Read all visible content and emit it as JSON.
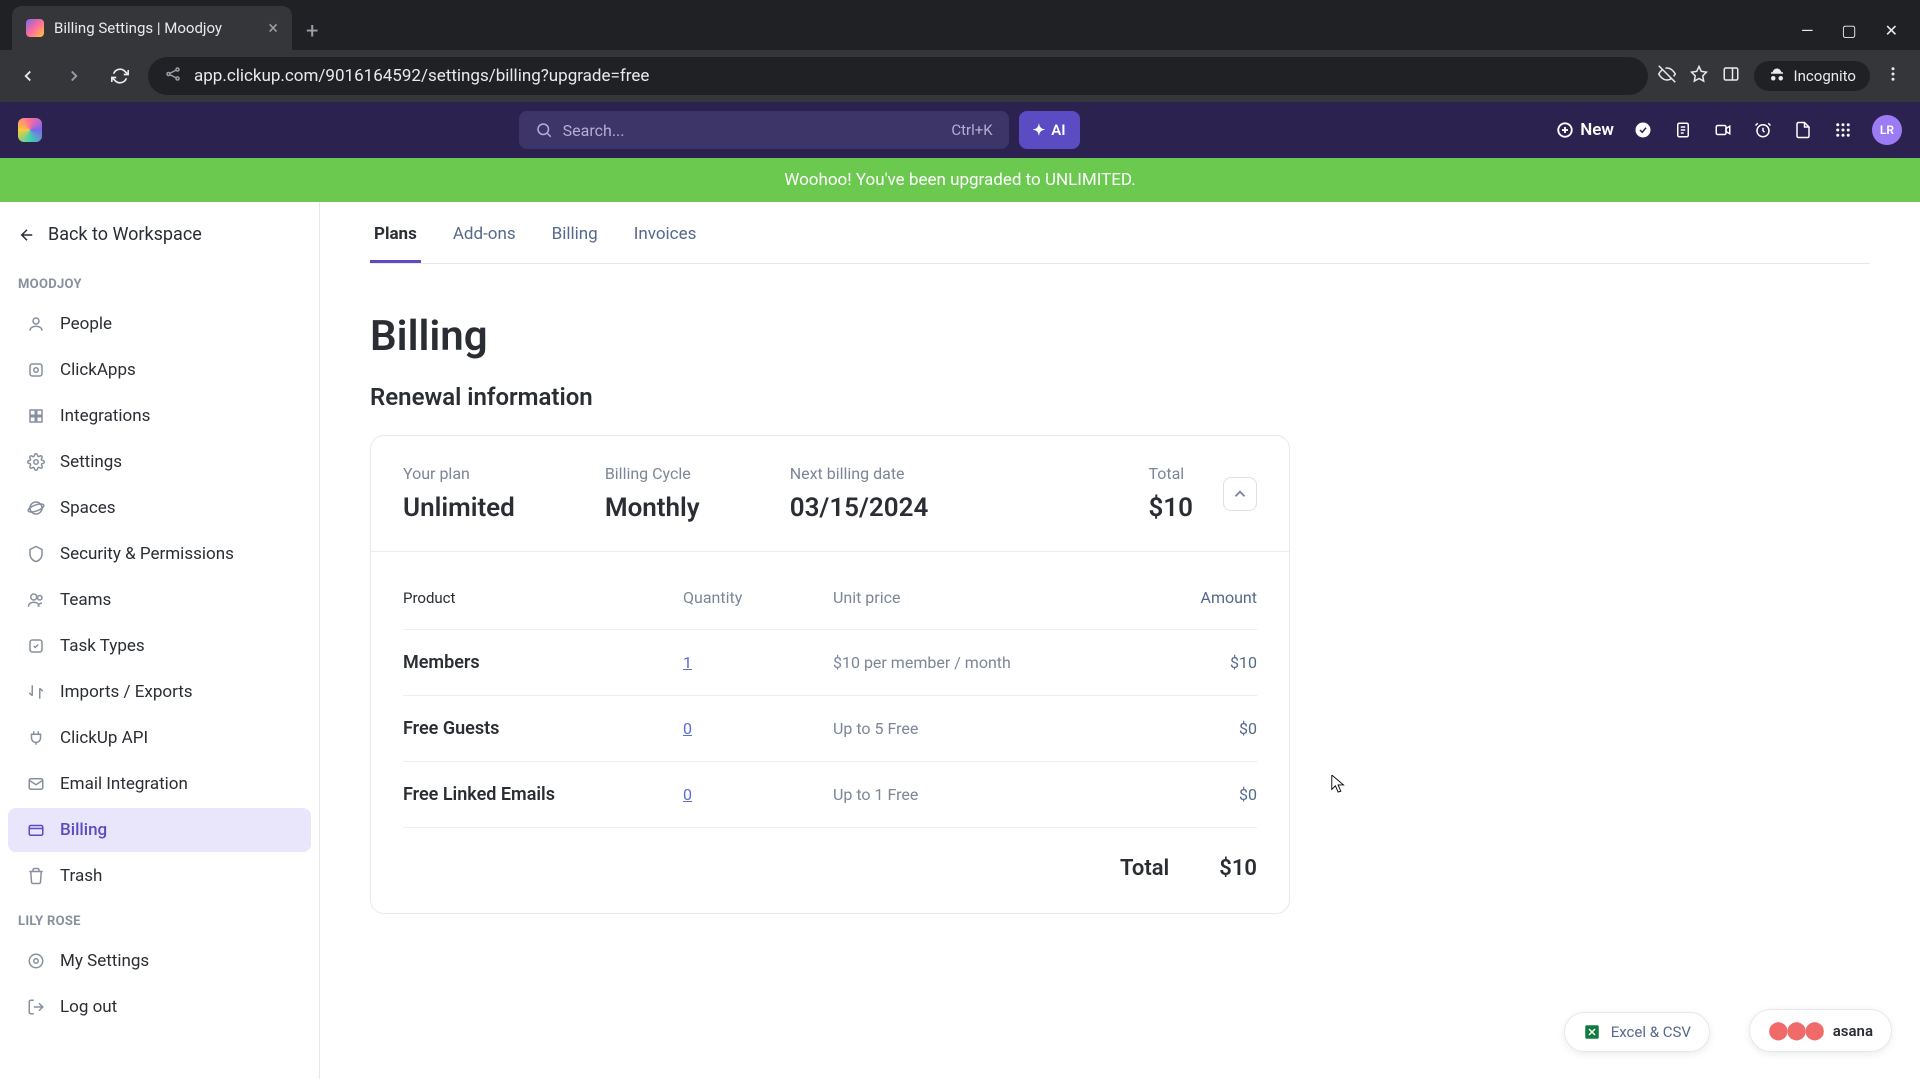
{
  "browser": {
    "tab_title": "Billing Settings | Moodjoy",
    "url": "app.clickup.com/9016164592/settings/billing?upgrade=free",
    "incognito": "Incognito"
  },
  "header": {
    "search_placeholder": "Search...",
    "search_kbd": "Ctrl+K",
    "ai_label": "AI",
    "new_label": "New",
    "avatar_initials": "LR"
  },
  "banner": "Woohoo! You've been upgraded to UNLIMITED.",
  "sidebar": {
    "back": "Back to Workspace",
    "section1": "MOODJOY",
    "section2": "LILY ROSE",
    "items": [
      {
        "label": "People"
      },
      {
        "label": "ClickApps"
      },
      {
        "label": "Integrations"
      },
      {
        "label": "Settings"
      },
      {
        "label": "Spaces"
      },
      {
        "label": "Security & Permissions"
      },
      {
        "label": "Teams"
      },
      {
        "label": "Task Types"
      },
      {
        "label": "Imports / Exports"
      },
      {
        "label": "ClickUp API"
      },
      {
        "label": "Email Integration"
      },
      {
        "label": "Billing"
      },
      {
        "label": "Trash"
      }
    ],
    "items2": [
      {
        "label": "My Settings"
      },
      {
        "label": "Log out"
      }
    ]
  },
  "tabs": [
    "Plans",
    "Add-ons",
    "Billing",
    "Invoices"
  ],
  "page": {
    "title": "Billing",
    "section": "Renewal information",
    "summary": {
      "plan_label": "Your plan",
      "plan_value": "Unlimited",
      "cycle_label": "Billing Cycle",
      "cycle_value": "Monthly",
      "next_label": "Next billing date",
      "next_value": "03/15/2024",
      "total_label": "Total",
      "total_value": "$10"
    },
    "table": {
      "headers": {
        "product": "Product",
        "qty": "Quantity",
        "unit": "Unit price",
        "amount": "Amount"
      },
      "rows": [
        {
          "product": "Members",
          "qty": "1",
          "unit": "$10 per member / month",
          "amount": "$10"
        },
        {
          "product": "Free Guests",
          "qty": "0",
          "unit": "Up to 5 Free",
          "amount": "$0"
        },
        {
          "product": "Free Linked Emails",
          "qty": "0",
          "unit": "Up to 1 Free",
          "amount": "$0"
        }
      ],
      "total_label": "Total",
      "total_value": "$10"
    }
  },
  "pills": {
    "excel": "Excel & CSV",
    "asana": "asana"
  }
}
